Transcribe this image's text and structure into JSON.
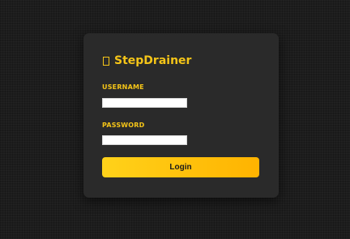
{
  "app": {
    "title": "StepDrainer",
    "logo_icon": "box-icon",
    "accent_color": "#f5c518"
  },
  "login_form": {
    "username_label": "USERNAME",
    "username_value": "",
    "password_label": "PASSWORD",
    "password_value": "",
    "submit_label": "Login",
    "button_gradient": [
      "#ffd21a",
      "#ffb300"
    ]
  }
}
